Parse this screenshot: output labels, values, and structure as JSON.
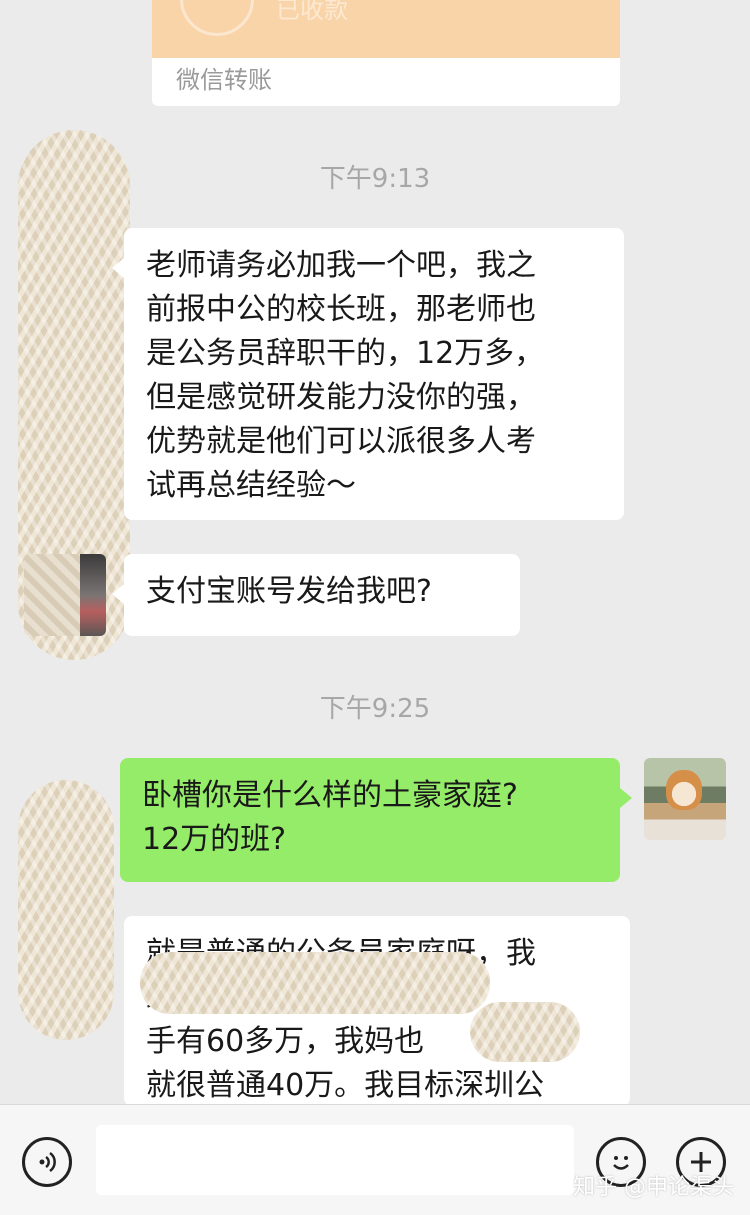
{
  "transfer": {
    "status": "已收款",
    "label": "微信转账"
  },
  "timestamps": [
    "下午9:13",
    "下午9:25"
  ],
  "messages": [
    {
      "text": "老师请务必加我一个吧，我之\n前报中公的校长班，那老师也\n是公务员辞职干的，12万多，\n但是感觉研发能力没你的强，\n优势就是他们可以派很多人考\n试再总结经验～"
    },
    {
      "text": "支付宝账号发给我吧?"
    },
    {
      "text": "卧槽你是什么样的土豪家庭?\n12万的班?"
    },
    {
      "text": "就是普通的公务员家庭呀，我\n级，到\n手有60多万，我妈也\n就很普通40万。我目标深圳公"
    }
  ],
  "input_bar": {
    "voice_icon": "voice-icon",
    "emoji_icon": "emoji-icon",
    "plus_icon": "plus-icon",
    "watermark": "知乎 @申论渠头"
  },
  "colors": {
    "background": "#ebebeb",
    "incoming": "#ffffff",
    "outgoing": "#95ec69",
    "transfer": "#f9d4a8"
  }
}
